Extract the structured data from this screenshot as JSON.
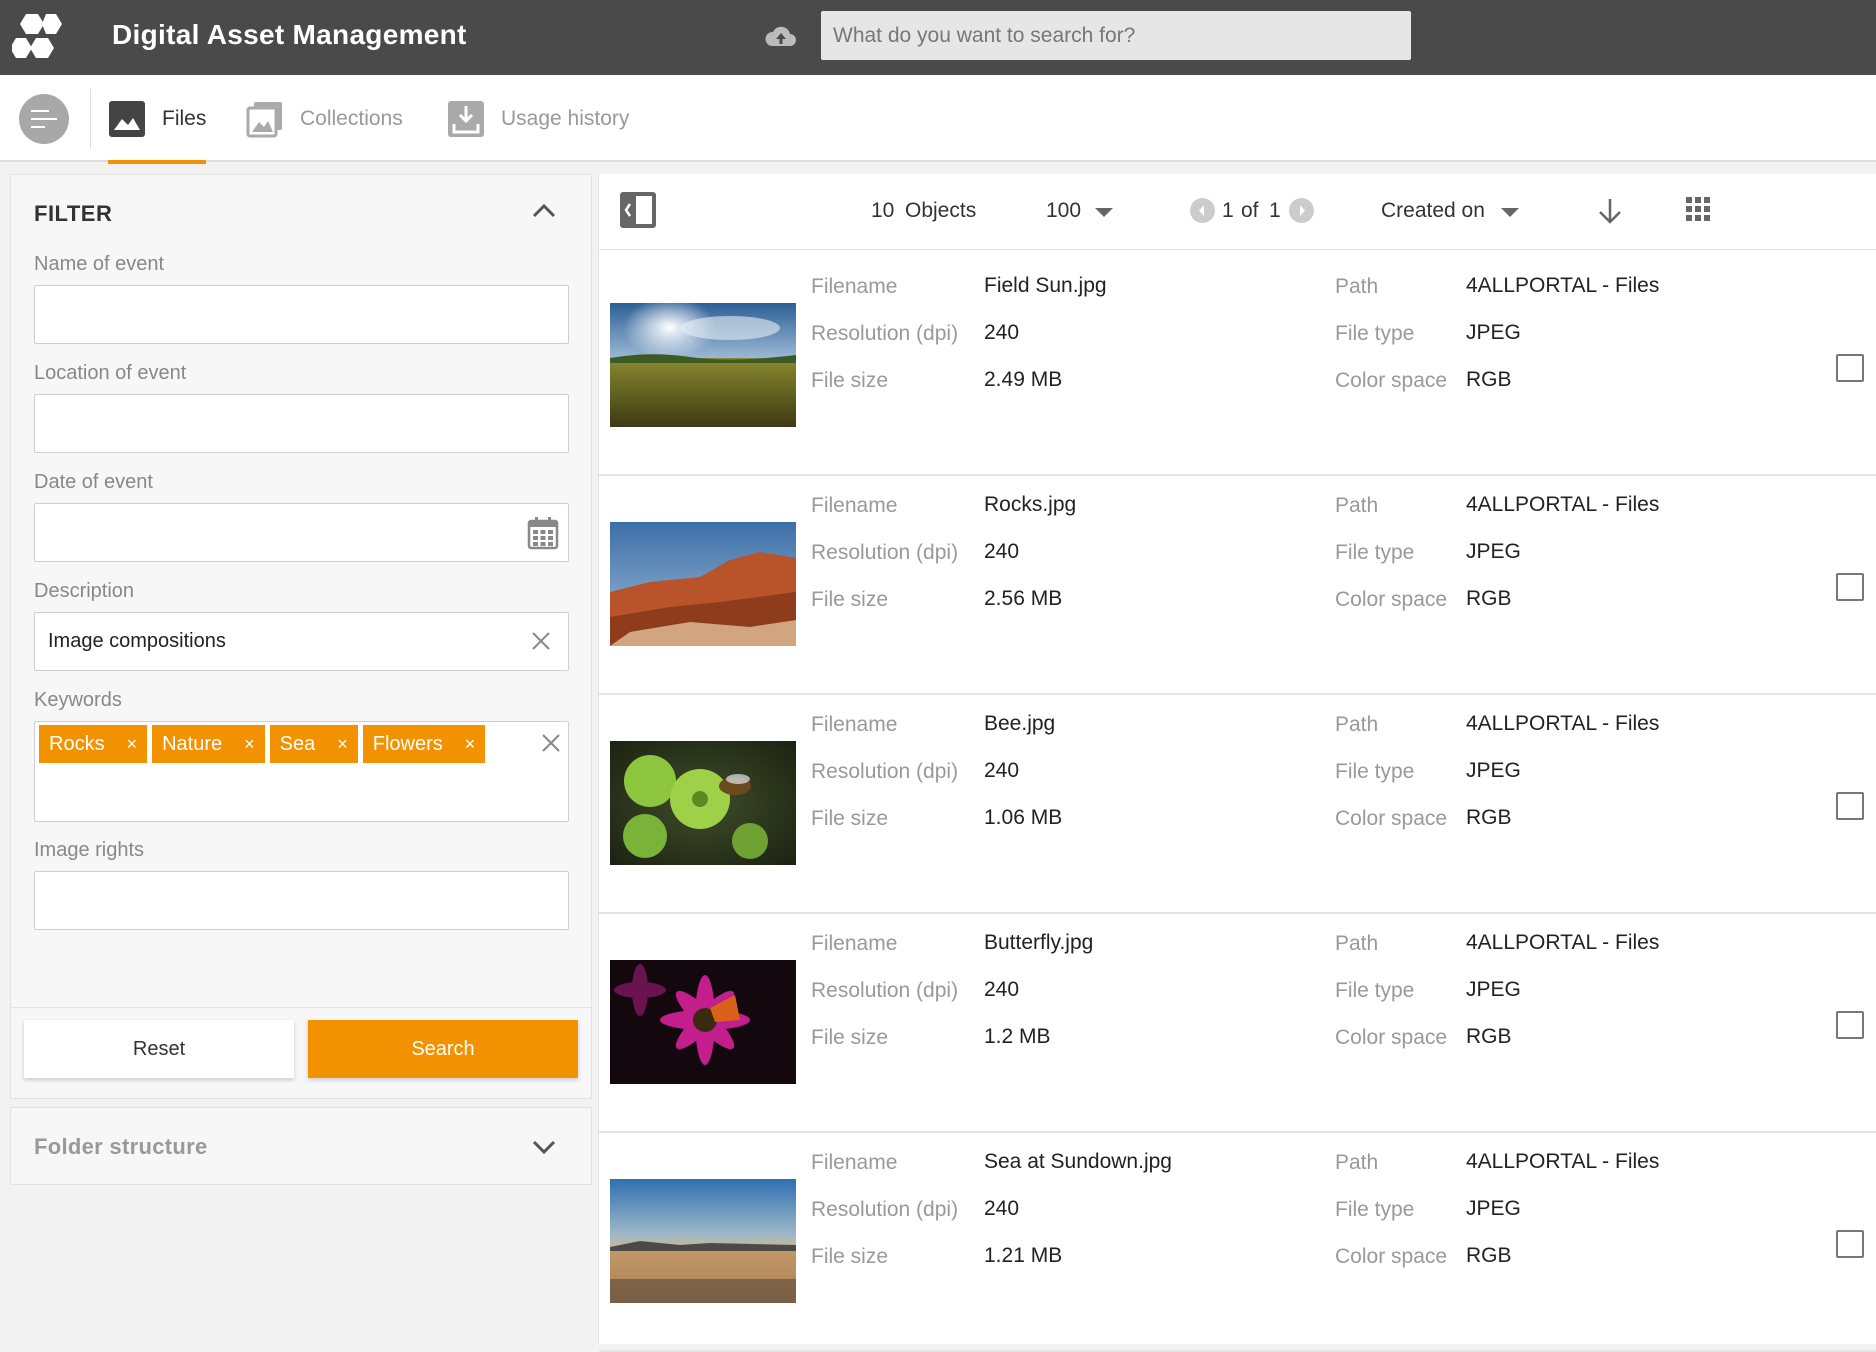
{
  "app": {
    "title": "Digital Asset Management"
  },
  "search": {
    "placeholder": "What do you want to search for?"
  },
  "tabs": [
    {
      "label": "Files",
      "active": true,
      "icon": "image-icon"
    },
    {
      "label": "Collections",
      "active": false,
      "icon": "collections-icon"
    },
    {
      "label": "Usage history",
      "active": false,
      "icon": "usage-history-icon"
    }
  ],
  "filter": {
    "heading": "FILTER",
    "fields": {
      "name_of_event": {
        "label": "Name of event",
        "value": ""
      },
      "location_of_event": {
        "label": "Location of event",
        "value": ""
      },
      "date_of_event": {
        "label": "Date of event",
        "value": ""
      },
      "description": {
        "label": "Description",
        "value": "Image compositions"
      },
      "keywords": {
        "label": "Keywords",
        "chips": [
          "Rocks",
          "Nature",
          "Sea",
          "Flowers"
        ]
      },
      "image_rights": {
        "label": "Image rights",
        "value": ""
      }
    },
    "reset_label": "Reset",
    "search_label": "Search"
  },
  "folder": {
    "title": "Folder structure"
  },
  "toolbar": {
    "count": "10",
    "count_label": "Objects",
    "per_page": "100",
    "page_current": "1",
    "page_of": "of",
    "page_total": "1",
    "sort_label": "Created on"
  },
  "labels": {
    "filename": "Filename",
    "resolution": "Resolution (dpi)",
    "filesize": "File size",
    "path": "Path",
    "filetype": "File type",
    "colorspace": "Color space"
  },
  "files": [
    {
      "filename": "Field Sun.jpg",
      "resolution": "240",
      "filesize": "2.49 MB",
      "path": "4ALLPORTAL - Files",
      "filetype": "JPEG",
      "colorspace": "RGB"
    },
    {
      "filename": "Rocks.jpg",
      "resolution": "240",
      "filesize": "2.56 MB",
      "path": "4ALLPORTAL - Files",
      "filetype": "JPEG",
      "colorspace": "RGB"
    },
    {
      "filename": "Bee.jpg",
      "resolution": "240",
      "filesize": "1.06 MB",
      "path": "4ALLPORTAL - Files",
      "filetype": "JPEG",
      "colorspace": "RGB"
    },
    {
      "filename": "Butterfly.jpg",
      "resolution": "240",
      "filesize": "1.2 MB",
      "path": "4ALLPORTAL - Files",
      "filetype": "JPEG",
      "colorspace": "RGB"
    },
    {
      "filename": "Sea at Sundown.jpg",
      "resolution": "240",
      "filesize": "1.21 MB",
      "path": "4ALLPORTAL - Files",
      "filetype": "JPEG",
      "colorspace": "RGB"
    }
  ],
  "colors": {
    "accent": "#f39200",
    "topbar": "#4a4a4a"
  }
}
